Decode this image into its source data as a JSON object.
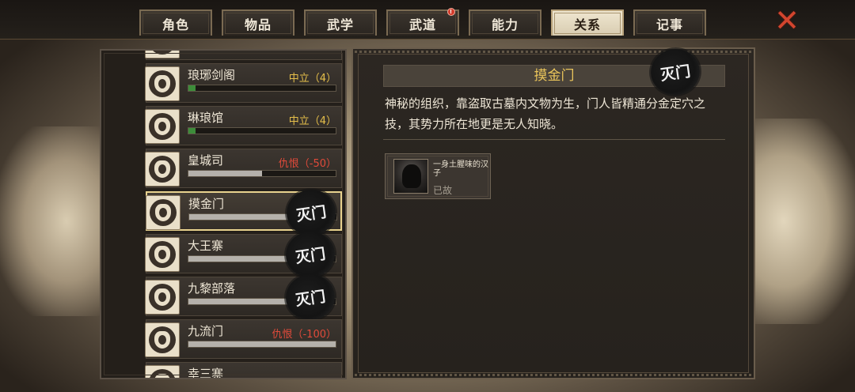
{
  "tabs": [
    {
      "label": "角色",
      "active": false
    },
    {
      "label": "物品",
      "active": false
    },
    {
      "label": "武学",
      "active": false
    },
    {
      "label": "武道",
      "active": false,
      "badge": "!"
    },
    {
      "label": "能力",
      "active": false
    },
    {
      "label": "关系",
      "active": true
    },
    {
      "label": "记事",
      "active": false
    }
  ],
  "close_icon": "close-x-icon",
  "factions": [
    {
      "name": "琅琊剑阁",
      "status": "中立（4）",
      "status_type": "neutral",
      "bar_fraction": 0.05,
      "bar_color": "green",
      "destroyed": false
    },
    {
      "name": "琳琅馆",
      "status": "中立（4）",
      "status_type": "neutral",
      "bar_fraction": 0.05,
      "bar_color": "green",
      "destroyed": false
    },
    {
      "name": "皇城司",
      "status": "仇恨（-50）",
      "status_type": "hostile",
      "bar_fraction": 0.5,
      "bar_color": "grey",
      "destroyed": false
    },
    {
      "name": "摸金门",
      "status": "",
      "status_type": "",
      "bar_fraction": 0.72,
      "bar_color": "grey",
      "destroyed": true,
      "selected": true
    },
    {
      "name": "大王寨",
      "status": "",
      "status_type": "",
      "bar_fraction": 0.72,
      "bar_color": "grey",
      "destroyed": true
    },
    {
      "name": "九黎部落",
      "status": "",
      "status_type": "",
      "bar_fraction": 0.72,
      "bar_color": "grey",
      "destroyed": true
    },
    {
      "name": "九流门",
      "status": "仇恨（-100）",
      "status_type": "hostile",
      "bar_fraction": 1.0,
      "bar_color": "grey",
      "destroyed": false
    }
  ],
  "partial_row_label": "幸三寨",
  "destroyed_stamp_text": "灭门",
  "detail": {
    "title": "摸金门",
    "description": "神秘的组织，靠盗取古墓内文物为生，门人皆精通分金定穴之技，其势力所在地更是无人知晓。",
    "members": [
      {
        "name": "一身土腥味的汉子",
        "status": "已故"
      }
    ]
  }
}
